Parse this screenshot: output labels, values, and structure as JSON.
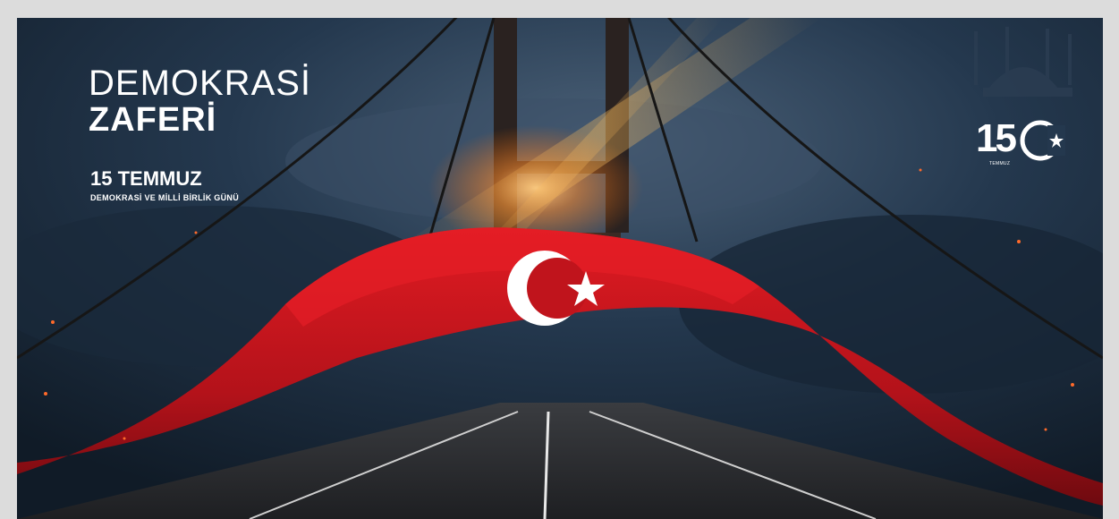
{
  "headline": {
    "line1": "DEMOKRASİ",
    "line2": "ZAFERİ"
  },
  "subtitle": {
    "date": "15 TEMMUZ",
    "day_name": "DEMOKRASİ VE MİLLİ BİRLİK GÜNÜ"
  },
  "logo": {
    "number": "15",
    "caption": "TEMMUZ"
  },
  "colors": {
    "sky": "#1c3046",
    "flag_red": "#c0141c",
    "road": "#2d2f33",
    "glow": "#ff8a2a"
  }
}
